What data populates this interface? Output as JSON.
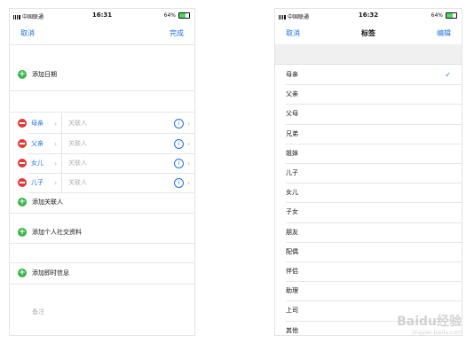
{
  "left": {
    "status": {
      "carrier": "中国联通",
      "time": "16:31",
      "battery": "64%"
    },
    "nav": {
      "cancel": "取消",
      "done": "完成"
    },
    "add_date": "添加日期",
    "relations": [
      {
        "label": "母亲",
        "placeholder": "关联人"
      },
      {
        "label": "父亲",
        "placeholder": "关联人"
      },
      {
        "label": "女儿",
        "placeholder": "关联人"
      },
      {
        "label": "儿子",
        "placeholder": "关联人"
      }
    ],
    "add_related": "添加关联人",
    "add_social": "添加个人社交资料",
    "add_im": "添加即时信息",
    "notes_placeholder": "备注"
  },
  "right": {
    "status": {
      "carrier": "中国联通",
      "time": "16:32",
      "battery": "64%"
    },
    "nav": {
      "cancel": "取消",
      "title": "标签",
      "edit": "编辑"
    },
    "labels": [
      "母亲",
      "父亲",
      "父母",
      "兄弟",
      "姐妹",
      "儿子",
      "女儿",
      "子女",
      "朋友",
      "配偶",
      "伴侣",
      "助理",
      "上司",
      "其他"
    ],
    "selected_index": 0
  },
  "watermark": {
    "text": "Baidu经验",
    "sub": "jingyan.baidu.com"
  },
  "colors": {
    "accent": "#1a73e8",
    "add_green": "#3bb54a",
    "remove_red": "#e53935"
  }
}
